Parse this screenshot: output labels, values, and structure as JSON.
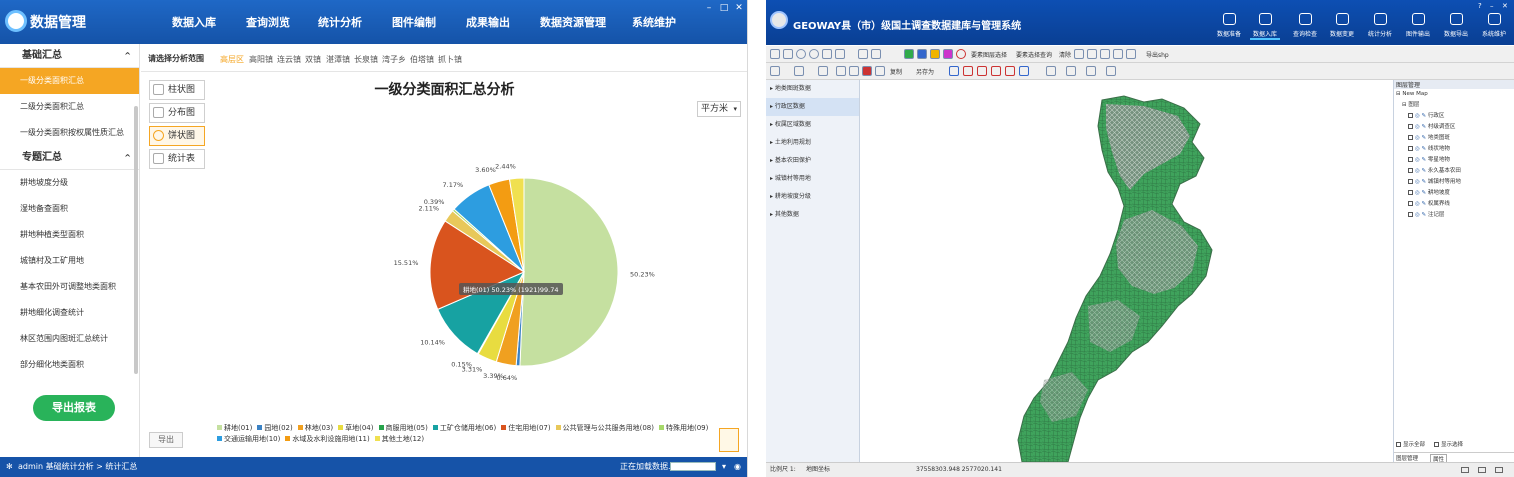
{
  "left_app": {
    "title": "数据管理",
    "menu": [
      "数据入库",
      "查询浏览",
      "统计分析",
      "图件编制",
      "成果输出",
      "数据资源管理",
      "系统维护"
    ],
    "window_controls": [
      "–",
      "□",
      "✕"
    ],
    "sidebar": {
      "sections": [
        {
          "label": "基础汇总",
          "items": [
            "一级分类面积汇总",
            "二级分类面积汇总",
            "一级分类面积按权属性质汇总"
          ]
        },
        {
          "label": "专题汇总",
          "items": [
            "耕地坡度分级",
            "湿地备查面积",
            "耕地种植类型面积",
            "城镇村及工矿用地",
            "基本农田外可调整地类面积",
            "耕地细化调查统计",
            "林区范围内图斑汇总统计",
            "部分细化地类面积"
          ]
        }
      ],
      "export_button": "导出报表"
    },
    "range_label": "请选择分析范围",
    "ranges": [
      "高层区",
      "高阳镇",
      "连云镇",
      "双镇",
      "湛潭镇",
      "长泉镇",
      "湾子乡",
      "伯塔镇",
      "抓卜镇"
    ],
    "view_buttons": [
      "柱状图",
      "分布图",
      "饼状图",
      "统计表"
    ],
    "unit_select": "平方米",
    "export_small": "导出",
    "status": {
      "left": "admin 基础统计分析 > 统计汇总",
      "right": "正在加载数据..."
    },
    "colors": {
      "accent": "#f5a623",
      "title_bar": "#1a5fbf",
      "export_green": "#29b35a"
    }
  },
  "chart_data": {
    "type": "pie",
    "title": "一级分类面积汇总分析",
    "slices": [
      {
        "name": "耕地(01)",
        "value": 50.23,
        "color": "#c5e0a0"
      },
      {
        "name": "园地(02)",
        "value": 0.64,
        "color": "#3b82c4"
      },
      {
        "name": "林地(03)",
        "value": 3.39,
        "color": "#f0a020"
      },
      {
        "name": "草地(04)",
        "value": 3.31,
        "color": "#e8dc40"
      },
      {
        "name": "商服用地(05)",
        "value": 0.15,
        "color": "#27a34b"
      },
      {
        "name": "工矿仓储用地(06)",
        "value": 10.14,
        "color": "#17a2a2"
      },
      {
        "name": "住宅用地(07)",
        "value": 15.51,
        "color": "#d9541e"
      },
      {
        "name": "公共管理与公共服务用地(08)",
        "value": 2.11,
        "color": "#e8c85a"
      },
      {
        "name": "特殊用地(09)",
        "value": 0.39,
        "color": "#a6d96a"
      },
      {
        "name": "交通运输用地(10)",
        "value": 7.17,
        "color": "#2d9de0"
      },
      {
        "name": "水域及水利设施用地(11)",
        "value": 3.6,
        "color": "#f39c12"
      },
      {
        "name": "其他土地(12)",
        "value": 2.44,
        "color": "#f0e050"
      }
    ],
    "tooltip": "耕地(01) 50.23% (1921)99.74"
  },
  "right_app": {
    "title": "GEOWAY县（市）级国土调查数据建库与管理系统",
    "modules": [
      "数据准备",
      "数据入库",
      "查询检查",
      "数据变更",
      "统计分析",
      "图件输出",
      "数据导出",
      "系统维护"
    ],
    "window_controls": [
      "?",
      "–",
      "✕"
    ],
    "toolbar_texts": [
      "要素图层选择",
      "要素选择查询",
      "清除",
      "复制",
      "另存为",
      "导出shp"
    ],
    "left_panel": [
      "地类图斑数据",
      "行政区数据",
      "权属区域数据",
      "土地利用规划",
      "基本农田保护",
      "城镇村等用地",
      "耕地坡度分级",
      "其他数据"
    ],
    "right_panel": {
      "header": "图层管理",
      "root": "New Map",
      "group": "图层",
      "layers": [
        "行政区",
        "村级调查区",
        "地类图斑",
        "线状地物",
        "零星地物",
        "永久基本农田",
        "城镇村等用地",
        "耕地坡度",
        "权属界线",
        "注记层"
      ],
      "bottom_tab1": "图层管理",
      "bottom_tab2": "属性",
      "bottom_check1": "显示全部",
      "bottom_check2": "显示选择"
    },
    "status": {
      "left": "比例尺 1:",
      "left2": "地图坐标",
      "coords": "37558303.948  2577020.141"
    }
  }
}
